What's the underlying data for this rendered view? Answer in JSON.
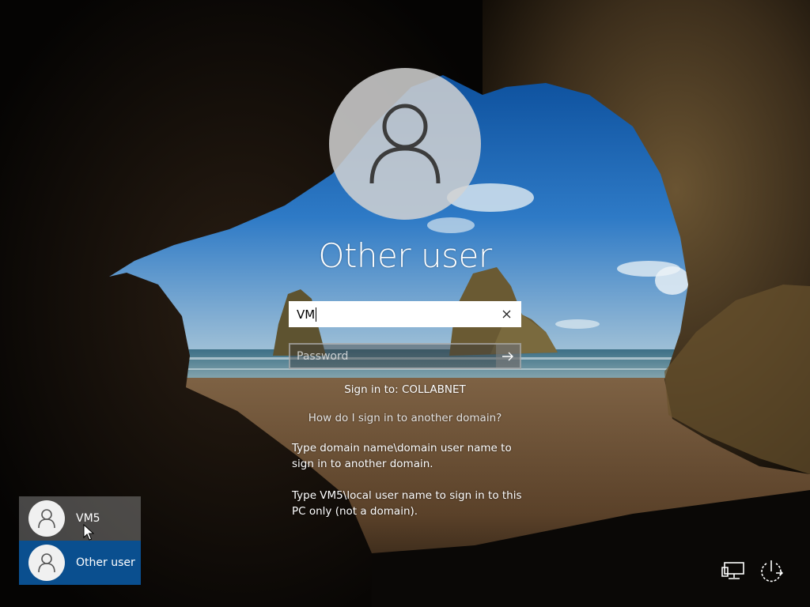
{
  "login": {
    "user_title": "Other user",
    "username_value": "VM",
    "password_placeholder": "Password",
    "sign_in_to": "Sign in to: COLLABNET",
    "help_link": "How do I sign in to another domain?",
    "hint_domain": "Type domain name\\domain user name to sign in to another domain.",
    "hint_local": "Type VM5\\local user name to sign in to this PC only (not a domain)."
  },
  "user_list": [
    {
      "name": "VM5",
      "selected": false
    },
    {
      "name": "Other user",
      "selected": true
    }
  ],
  "system_icons": [
    "network-icon",
    "power-icon"
  ],
  "colors": {
    "selected_tile": "#0a4f8f",
    "sky": "#2a6fb5",
    "sand": "#8a6a4a",
    "cave_rock": "#3a2a1a"
  }
}
